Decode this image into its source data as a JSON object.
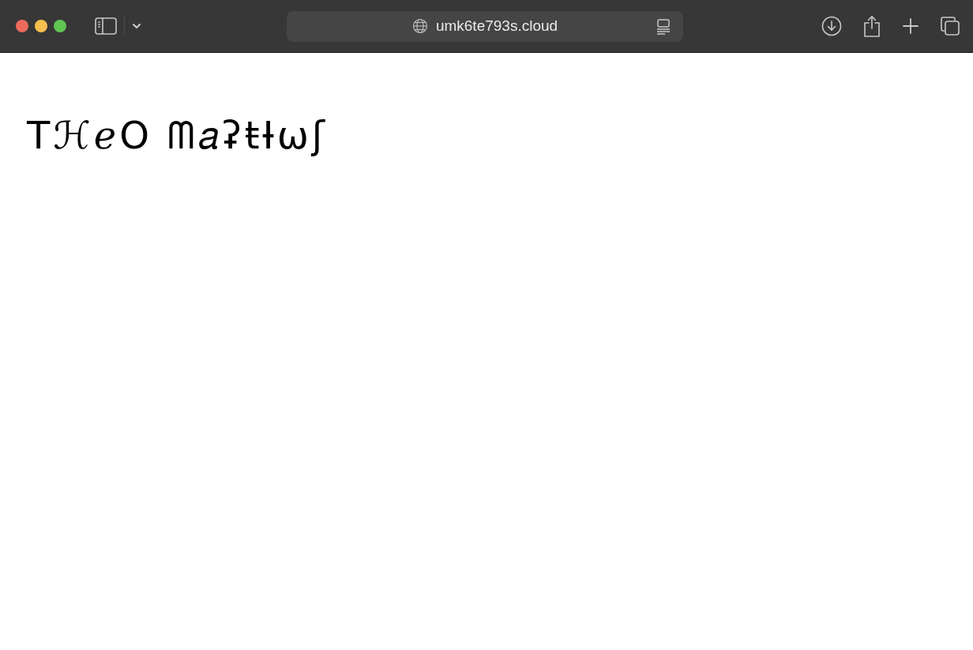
{
  "browser": {
    "address": "umk6te793s.cloud"
  },
  "page": {
    "heading": "TℋℯO ᗰ𝑎ʡŧƗωʃ"
  }
}
